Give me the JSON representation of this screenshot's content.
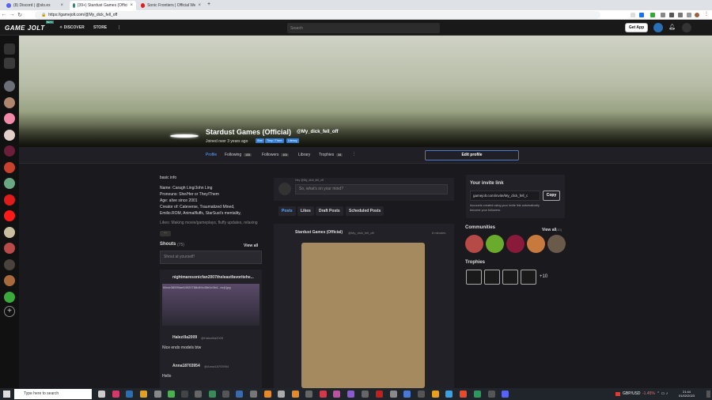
{
  "browser": {
    "tabs": [
      {
        "title": "(8) Discord | @slo.ex",
        "color": "#5865f2"
      },
      {
        "title": "(39+) Stardust Games (Official) @My_dick_fell_off - Game Jolt",
        "color": "#2f7f6f"
      },
      {
        "title": "Sonic Frontiers | Official Website",
        "color": "#e21b1b"
      }
    ],
    "new_tab": "+",
    "url": "https://gamejolt.com/@My_dick_fell_off"
  },
  "site": {
    "logo": "GAME JOLT",
    "logo_badge": "BETA",
    "nav": [
      "DISCOVER",
      "STORE"
    ],
    "more": "⋮",
    "search_placeholder": "Search",
    "get_app": "Get App"
  },
  "sidebar": {
    "colors": [
      "#6b6f77",
      "#b0876e",
      "#f08aa8",
      "#e2d0c8",
      "#6a1e3a",
      "#c8412c",
      "#6aa884",
      "#e01b1b",
      "#ff1a1a",
      "#c7bf9f",
      "#b84a4a",
      "#4a423c",
      "#a86a3a",
      "#3aaa3a"
    ],
    "add": "+"
  },
  "profile": {
    "name": "Stardust Games (Official)",
    "handle": "@My_dick_fell_off",
    "joined": "Joined over 3 years ago",
    "tags": [
      "She/",
      "They / Them",
      "Literary"
    ],
    "nav": [
      {
        "label": "Profile",
        "count": ""
      },
      {
        "label": "Following",
        "count": "133"
      },
      {
        "label": "Followers",
        "count": "101"
      },
      {
        "label": "Library",
        "count": ""
      },
      {
        "label": "Trophies",
        "count": "34"
      }
    ],
    "edit_button": "Edit profile"
  },
  "bio": {
    "heading": "basic info",
    "lines": [
      "Name: Caragh Ling/John Ling",
      "Pronouns: She/Her or They/Them",
      "Age: alive since 2001",
      "Creator of: Cateverse, Traumatized Mined,",
      "Emilio.ROM, Animalfluffs, StarSust's mentality,",
      "Likes: Making movie/gameplays, fluffy updates, relaxing"
    ],
    "more_button": "⋯"
  },
  "shouts": {
    "title": "Shouts",
    "count": "(75)",
    "view_all": "View all",
    "placeholder": "Shout at yourself!",
    "items": [
      {
        "user": "nightmaresonicfan2007theleastfavoritehe...",
        "handle": "",
        "text": "",
        "file": "f4ece38599ae64920768c89c45e0c3b4...ez(f.jpg"
      },
      {
        "user": "Halezilla2009",
        "handle": "@Halezilla2009",
        "text": "Nice endo models btw"
      },
      {
        "user": "Anna18703954",
        "handle": "@Anna18703954",
        "text": "Hello"
      }
    ]
  },
  "composer": {
    "handle": "Hey @My_dick_fell_off",
    "placeholder": "So, what's on your mind?",
    "tabs": [
      "Posts",
      "Likes",
      "Draft Posts",
      "Scheduled Posts"
    ]
  },
  "post": {
    "author": "Stardust Games (Official)",
    "handle": "@My_dick_fell_off",
    "time": "6 minutes"
  },
  "invite": {
    "title": "Your invite link",
    "link": "gamejolt.com/invite/My_dick_fell_c",
    "copy": "Copy",
    "note1": "Accounts created using your invite link automatically",
    "note2": "become your followers."
  },
  "communities": {
    "title": "Communities",
    "view_all": "View all",
    "view_count": "(10)",
    "colors": [
      "#b64a47",
      "#6aab2e",
      "#8a1a3a",
      "#c8793e",
      "#6a5a4a"
    ]
  },
  "trophies": {
    "title": "Trophies",
    "extra": "+10"
  },
  "taskbar": {
    "search_placeholder": "Type here to search",
    "currency": "GBP/USD",
    "change": "-1.45%",
    "time": "21:44",
    "date": "01/02/2023"
  }
}
